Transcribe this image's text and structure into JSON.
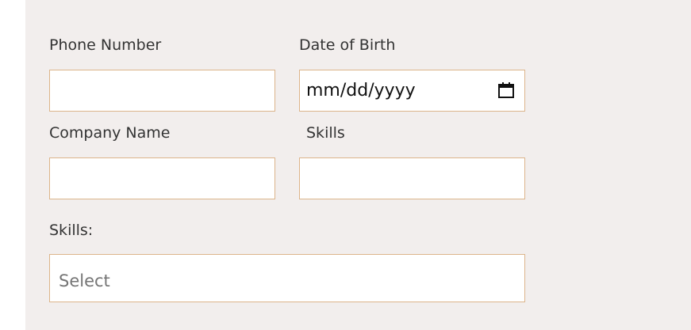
{
  "form": {
    "phone_label": "Phone Number",
    "dob_label": "Date of Birth",
    "dob_placeholder": "mm/dd/yyyy",
    "company_label": "Company Name",
    "skills_label": "Skills",
    "skills_select_label": "Skills:",
    "skills_select_placeholder": "Select"
  },
  "colors": {
    "panel_background": "#f2eeed",
    "field_border": "#dcb48a"
  },
  "icons": {
    "date_picker": "calendar-icon"
  }
}
